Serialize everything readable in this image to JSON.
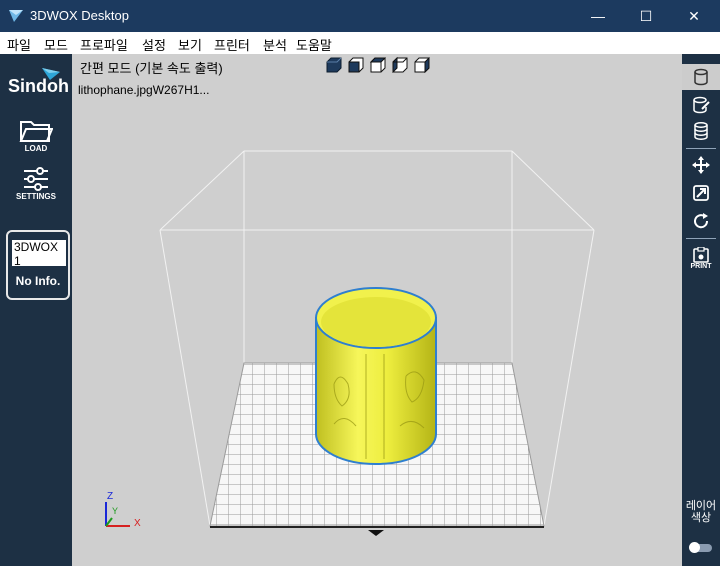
{
  "window": {
    "title": "3DWOX Desktop",
    "minimize": "—",
    "maximize": "☐",
    "close": "✕"
  },
  "menu": [
    "파일",
    "모드",
    "프로파일",
    "설정",
    "보기",
    "프린터",
    "분석",
    "도움말"
  ],
  "sidebar": {
    "logo": "Sindoh",
    "load_label": "LOAD",
    "settings_label": "SETTINGS",
    "device_name": "3DWOX 1",
    "device_info": "No Info."
  },
  "viewport": {
    "mode_text": "간편 모드 (기본 속도 출력)",
    "file_name": "lithophane.jpgW267H1...",
    "axis_labels": {
      "x": "X",
      "y": "Y",
      "z": "Z"
    }
  },
  "right_toolbar": {
    "print_label": "PRINT",
    "layer_color_label": "레이어 색상"
  },
  "colors": {
    "titlebar": "#1c3a5f",
    "sidebar": "#1d3044",
    "viewport_bg": "#cfcfcf",
    "model": "#f2f24a",
    "model_edge": "#2f7fcf"
  },
  "icons": {
    "app": "3dwox-app-icon",
    "load": "folder-icon",
    "settings": "sliders-icon",
    "right_tools": [
      "cylinder-icon",
      "cylinder-edit-icon",
      "database-icon",
      "move-icon",
      "scale-icon",
      "rotate-icon",
      "print-icon"
    ]
  }
}
